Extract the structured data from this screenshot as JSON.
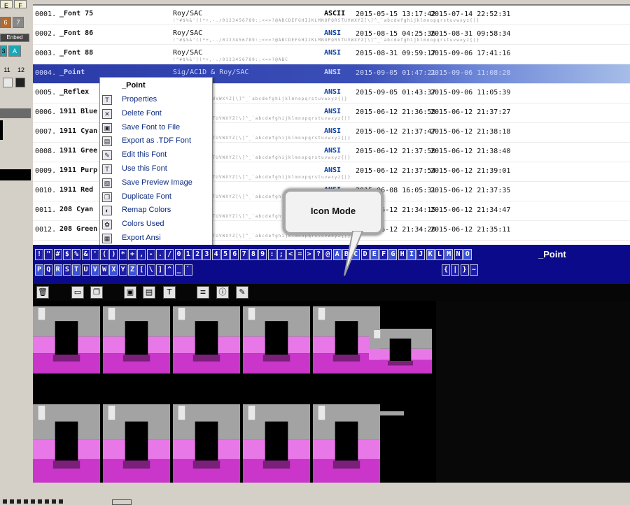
{
  "left_panel": {
    "keys": [
      "E",
      "F",
      "6",
      "7",
      "Enbed",
      "3",
      "A",
      "11",
      "12"
    ]
  },
  "fonts": [
    {
      "num": "0001.",
      "name": "_Font 75",
      "author": "Roy/SAC",
      "sample": " !\"#$%&'()*+,-./0123456789:;<=>?@ABCDEFGHIJKLMNOPQRSTUVWXYZ[\\]^_`abcdefghijklmnopqrstuvwxyz{|}",
      "encoding": "ASCII",
      "created": "2015-05-15 13:17:42",
      "modified": "2015-07-14 22:52:31"
    },
    {
      "num": "0002.",
      "name": "_Font 86",
      "author": "Roy/SAC",
      "sample": " !\"#$%&'()*+,-./0123456789:;<=>?@ABCDEFGHIJKLMNOPQRSTUVWXYZ[\\]^_`abcdefghijklmnopqrstuvwxyz{|}",
      "encoding": "ANSI",
      "created": "2015-08-15 04:25:36",
      "modified": "2015-08-31 09:58:34"
    },
    {
      "num": "0003.",
      "name": "_Font 88",
      "author": "Roy/SAC",
      "sample": " !\"#$%&'()*+,-./0123456789:;<=>?@ABC",
      "encoding": "ANSI",
      "created": "2015-08-31 09:59:17",
      "modified": "2015-09-06 17:41:16"
    },
    {
      "num": "0004.",
      "name": "_Point",
      "author": "Sig/AC1D & Roy/SAC",
      "sample": "IJKL NOP R T",
      "encoding": "ANSI",
      "created": "2015-09-05 01:47:21",
      "modified": "2015-09-06 11:08:28",
      "selected": true
    },
    {
      "num": "0005.",
      "name": "_Reflex",
      "author": "& Roy/SAC",
      "sample": "IJKLMNOPQRSTUVWXYZ[\\]^_`abcdefghijklmnopqrstuvwxyz{|}",
      "encoding": "ANSI",
      "created": "2015-09-05 01:43:37",
      "modified": "2015-09-06 11:05:39"
    },
    {
      "num": "0006.",
      "name": "1911 Blue",
      "author": "",
      "sample": "HIJKLMNOPQRSTUVWXYZ[\\]^_`abcdefghijklmnopqrstuvwxyz{|}",
      "encoding": "ANSI",
      "created": "2015-06-12 21:36:58",
      "modified": "2015-06-12 21:37:27"
    },
    {
      "num": "0007.",
      "name": "1911 Cyan",
      "author": "",
      "sample": "HIJKLMNOPQRSTUVWXYZ[\\]^_`abcdefghijklmnopqrstuvwxyz{|}",
      "encoding": "ANSI",
      "created": "2015-06-12 21:37:47",
      "modified": "2015-06-12 21:38:18"
    },
    {
      "num": "0008.",
      "name": "1911 Gree",
      "author": "",
      "sample": "HIJKLMNOPQRSTUVWXYZ[\\]^_`abcdefghijklmnopqrstuvwxyz{|}",
      "encoding": "ANSI",
      "created": "2015-06-12 21:37:50",
      "modified": "2015-06-12 21:38:40"
    },
    {
      "num": "0009.",
      "name": "1911 Purp",
      "author": "",
      "sample": "HIJKLMNOPQRSTUVWXYZ[\\]^_`abcdefghijklmnopqrstuvwxyz{|}",
      "encoding": "ANSI",
      "created": "2015-06-12 21:37:54",
      "modified": "2015-06-12 21:39:01"
    },
    {
      "num": "0010.",
      "name": "1911 Red",
      "author": "",
      "sample": "HIJKLMNOPQRSTUVWXYZ[\\]^_`abcdefghijklmnopqrstuvwxyz{|}",
      "encoding": "ANSI",
      "created": "2015-06-08 16:05:31",
      "modified": "2015-06-12 21:37:35"
    },
    {
      "num": "0011.",
      "name": "208 Cyan",
      "author": "y/SAC",
      "sample": "HIJKLMNOPQRSTUVWXYZ[\\]^_`abcdefghijklmnopqrstuvwxyz{|}",
      "encoding": "ANSI",
      "created": "2015-06-12 21:34:15",
      "modified": "2015-06-12 21:34:47"
    },
    {
      "num": "0012.",
      "name": "208 Green",
      "author": "y/SAC",
      "sample": "HIJKLMNOPQRSTUVWXYZ[\\]^_`abcdefghijklmnopqrstuvwxyz{|}",
      "encoding": "ANSI",
      "created": "2015-06-12 21:34:20",
      "modified": "2015-06-12 21:35:11"
    }
  ],
  "context_menu": {
    "title": "_Point",
    "items": [
      {
        "label": "Properties",
        "icon": "properties-icon"
      },
      {
        "label": "Delete Font",
        "icon": "delete-icon"
      },
      {
        "label": "Save Font to File",
        "icon": "save-icon"
      },
      {
        "label": "Export as .TDF Font",
        "icon": "export-tdf-icon"
      },
      {
        "label": "Edit this Font",
        "icon": "edit-icon"
      },
      {
        "label": "Use this Font",
        "icon": "use-font-icon"
      },
      {
        "label": "Save Preview Image",
        "icon": "image-icon"
      },
      {
        "label": "Duplicate Font",
        "icon": "duplicate-icon"
      },
      {
        "label": "Remap Colors",
        "icon": "remap-icon"
      },
      {
        "label": "Colors Used",
        "icon": "palette-icon"
      },
      {
        "label": "Export Ansi",
        "icon": "export-ansi-icon"
      }
    ]
  },
  "char_bar": {
    "row1": [
      "!",
      "\"",
      "#",
      "$",
      "%",
      "&",
      "'",
      "(",
      ")",
      "*",
      "+",
      ",",
      "-",
      ".",
      "/",
      "0",
      "1",
      "2",
      "3",
      "4",
      "5",
      "6",
      "7",
      "8",
      "9",
      ":",
      ";",
      "<",
      "=",
      ">",
      "?",
      "@",
      "A",
      "B",
      "C",
      "D",
      "E",
      "F",
      "G",
      "H",
      "I",
      "J",
      "K",
      "L",
      "M",
      "N",
      "O"
    ],
    "row2": [
      "P",
      "Q",
      "R",
      "S",
      "T",
      "U",
      "V",
      "W",
      "X",
      "Y",
      "Z",
      "[",
      "\\",
      "]",
      "^",
      "_",
      "`"
    ],
    "row2_right": [
      "{",
      "|",
      "}",
      "~"
    ],
    "font_name": "_Point"
  },
  "toolbar": {
    "icons": [
      "trash-icon",
      "window-icon",
      "copy-icon",
      "display-icon",
      "save-icon",
      "tdf-icon",
      "text-icon",
      "info-icon",
      "pen-icon"
    ]
  },
  "callout": {
    "text": "Icon Mode"
  },
  "preview": {
    "colors": {
      "gray": "#a3a3a3",
      "light": "#e8e8e8",
      "magenta": "#c936c9",
      "dark_magenta": "#7a1f7a",
      "pink": "#e878e8"
    }
  }
}
